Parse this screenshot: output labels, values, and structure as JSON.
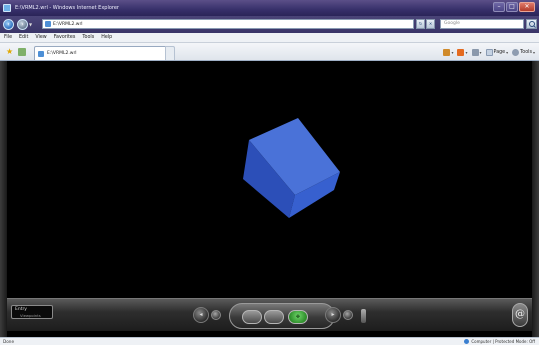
{
  "window": {
    "title": "E:\\VRML2.wrl - Windows Internet Explorer",
    "controls": {
      "minimize": "–",
      "maximize": "□",
      "close": "✕"
    }
  },
  "address_bar": {
    "url": "E:\\VRML2.wrl",
    "search_placeholder": "Google",
    "go_label": "→"
  },
  "menu": {
    "items": [
      "File",
      "Edit",
      "View",
      "Favorites",
      "Tools",
      "Help"
    ]
  },
  "tab": {
    "label": "E:\\VRML2.wrl"
  },
  "command_bar": {
    "page_label": "Page",
    "tools_label": "Tools"
  },
  "scene": {
    "object": "cube",
    "colors": {
      "top": "#4a72d8",
      "left": "#2c4fb8",
      "front": "#3760cf",
      "background": "#000000"
    }
  },
  "viewer": {
    "viewpoint_label": "Entry",
    "viewpoint_sub": "Viewpoints",
    "walk_label": "",
    "fly_label": "",
    "study_label": "✥"
  },
  "status": {
    "left": "Done",
    "zone": "Computer | Protected Mode: Off"
  }
}
